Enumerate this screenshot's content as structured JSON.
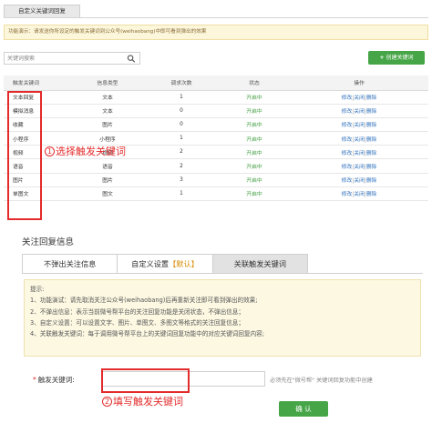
{
  "top_tab": {
    "label": "自定义关键词回复"
  },
  "notice": {
    "text": "功能演示：请发送你所设定的触发关键词到公众号(weihaobang)中即可看到弹出的效果"
  },
  "search": {
    "placeholder": "关键词搜索"
  },
  "create_button": {
    "label": "创建关键词"
  },
  "table": {
    "headers": [
      "触发关键词",
      "信息类型",
      "调求次数",
      "状态",
      "操作"
    ],
    "rows": [
      {
        "keyword": "文本回复",
        "type": "文本",
        "count": "1",
        "status": "开启中"
      },
      {
        "keyword": "模拟消息",
        "type": "文本",
        "count": "0",
        "status": "开启中"
      },
      {
        "keyword": "收藏",
        "type": "图片",
        "count": "0",
        "status": "开启中"
      },
      {
        "keyword": "小程序",
        "type": "小程序",
        "count": "1",
        "status": "开启中"
      },
      {
        "keyword": "视频",
        "type": "视频",
        "count": "2",
        "status": "开启中"
      },
      {
        "keyword": "语音",
        "type": "语音",
        "count": "2",
        "status": "开启中"
      },
      {
        "keyword": "图片",
        "type": "图片",
        "count": "3",
        "status": "开启中"
      },
      {
        "keyword": "单图文",
        "type": "图文",
        "count": "1",
        "status": "开启中"
      }
    ],
    "ops": {
      "edit": "修改",
      "close": "关闭",
      "delete": "删除",
      "separator": "|"
    }
  },
  "annotations": {
    "one_num": "1",
    "one_text": "选择触发关键词",
    "two_num": "2",
    "two_text": "填写触发关键词"
  },
  "section": {
    "title": "关注回复信息"
  },
  "reply_tabs": {
    "tab1": "不弹出关注信息",
    "tab2_prefix": "自定义设置",
    "tab2_highlight": "【默认】",
    "tab3": "关联触发关键词"
  },
  "tips": {
    "lines": [
      "提示:",
      "1、功能演试：请先取消关注公众号(weihaobang)后再重新关注即可看到弹出的效果;",
      "2、不弹出信息：表示当前微号帮平台的关注回复功能是关闭状态，不弹出信息；",
      "3、自定义设置：可以设置文字、图片、单图文、多图文等格式的关注回复信息；",
      "4、关联触发关键词：每于调用微号帮平台上的关键词回复功能中的对应关键词回复内容;"
    ]
  },
  "form": {
    "required_mark": "*",
    "label": "触发关键词:",
    "value": "",
    "hint": "必须先在\"微号帮\" 关键词回复功能中创建"
  },
  "confirm_button": {
    "label": "确 认"
  },
  "colors": {
    "green": "#46a546",
    "annotation_red": "#e32b2b",
    "status_green": "#3c9b3c",
    "link_blue": "#2d6fbd"
  }
}
